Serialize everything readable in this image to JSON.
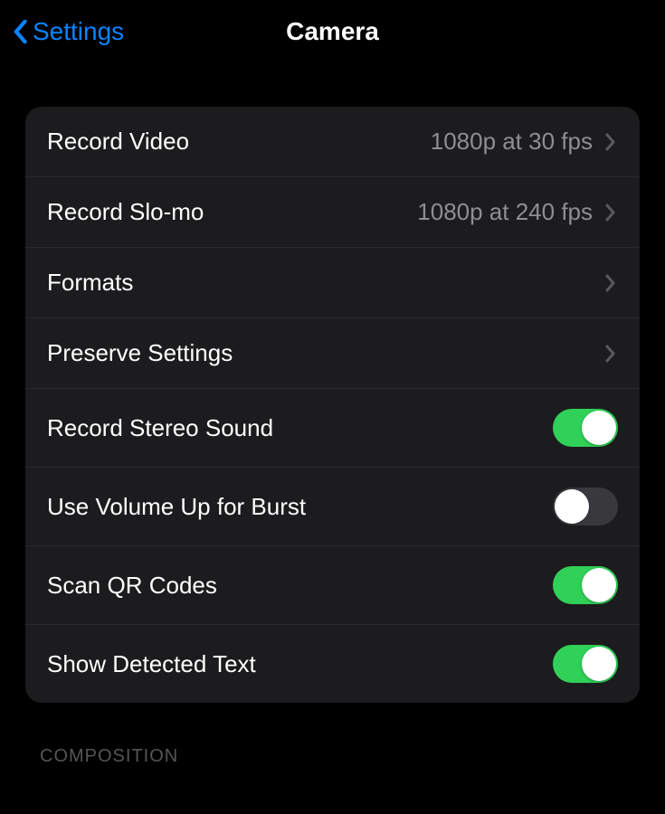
{
  "nav": {
    "back_label": "Settings",
    "title": "Camera"
  },
  "rows": [
    {
      "label": "Record Video",
      "value": "1080p at 30 fps",
      "type": "nav"
    },
    {
      "label": "Record Slo-mo",
      "value": "1080p at 240 fps",
      "type": "nav"
    },
    {
      "label": "Formats",
      "value": "",
      "type": "nav"
    },
    {
      "label": "Preserve Settings",
      "value": "",
      "type": "nav"
    },
    {
      "label": "Record Stereo Sound",
      "type": "toggle",
      "on": true
    },
    {
      "label": "Use Volume Up for Burst",
      "type": "toggle",
      "on": false
    },
    {
      "label": "Scan QR Codes",
      "type": "toggle",
      "on": true
    },
    {
      "label": "Show Detected Text",
      "type": "toggle",
      "on": true
    }
  ],
  "next_section_header": "COMPOSITION"
}
